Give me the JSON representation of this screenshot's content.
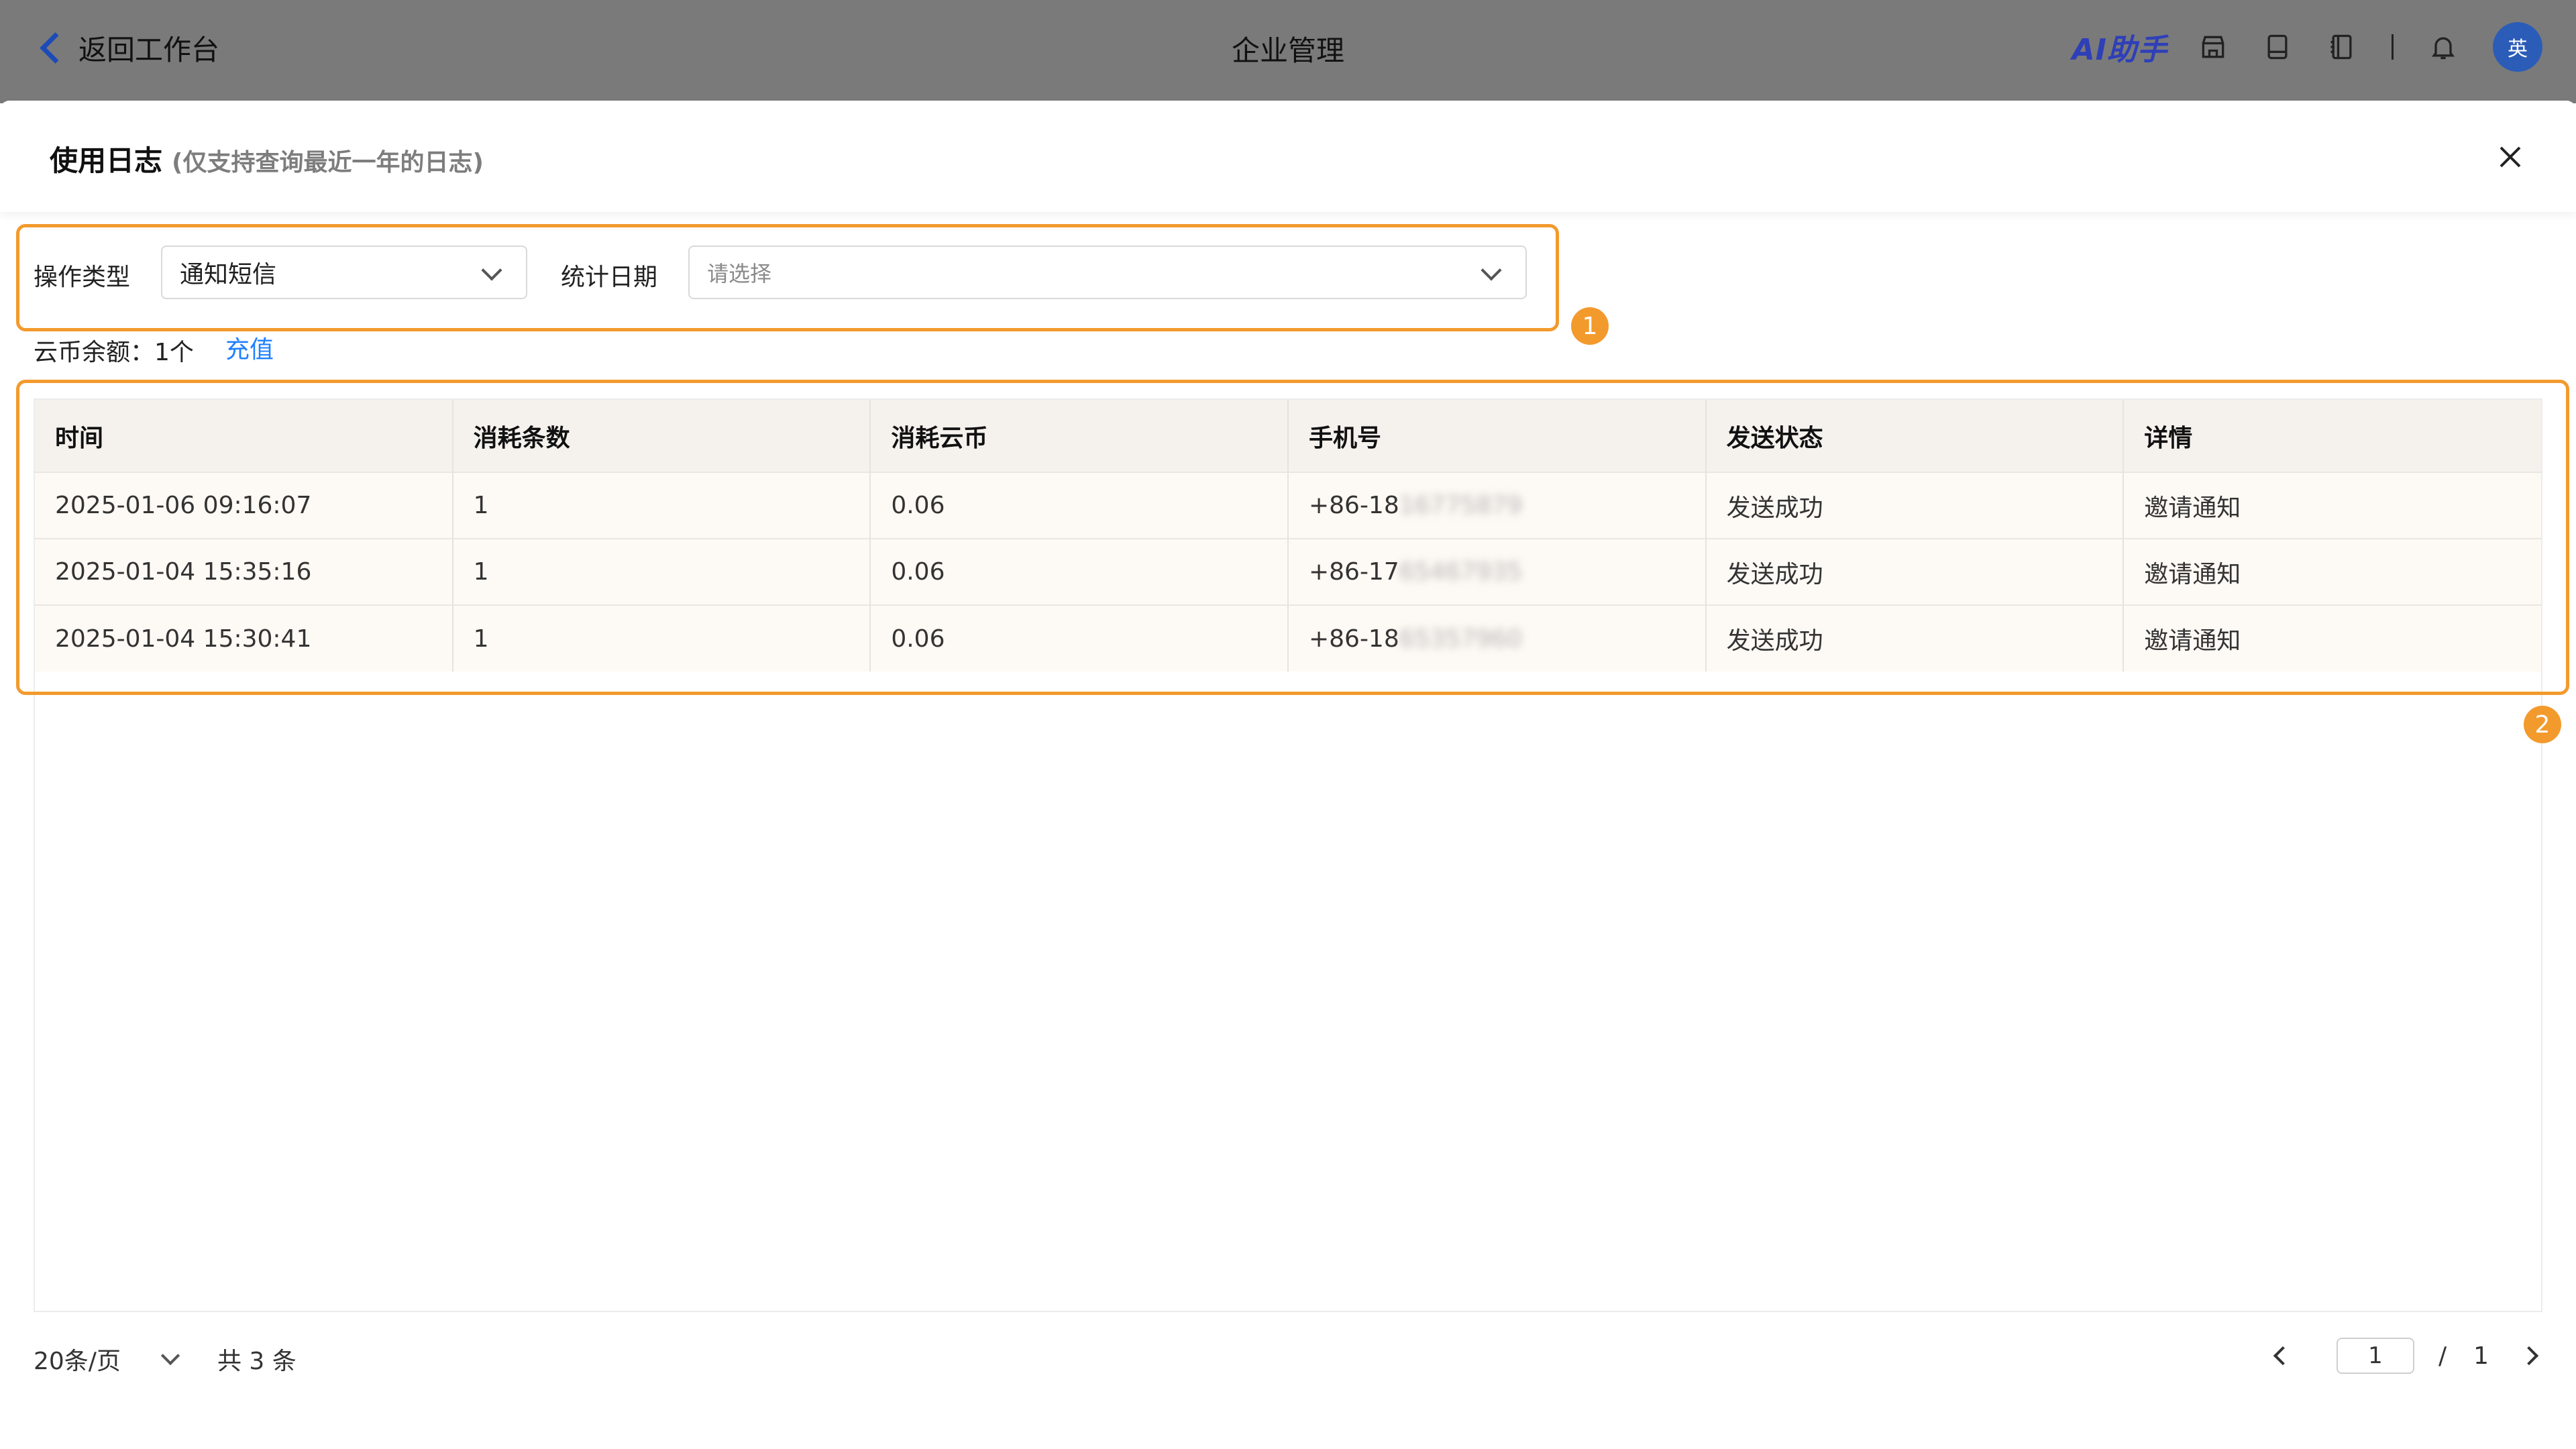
{
  "topbar": {
    "back_label": "返回工作台",
    "title": "企业管理",
    "ai_label": "AI助手",
    "avatar_text": "英",
    "accent": "#2e3fb8",
    "icons": [
      "store-icon",
      "book-icon",
      "notebook-icon",
      "bell-icon"
    ]
  },
  "dialog": {
    "title": "使用日志",
    "subtitle": "(仅支持查询最近一年的日志)"
  },
  "filters": {
    "op_type_label": "操作类型",
    "op_type_value": "通知短信",
    "date_label": "统计日期",
    "date_placeholder": "请选择"
  },
  "balance": {
    "text": "云币余额：1个",
    "recharge_label": "充值"
  },
  "annotations": {
    "badge1": "1",
    "badge2": "2",
    "highlight_color": "#f39a2d"
  },
  "table": {
    "columns": [
      "时间",
      "消耗条数",
      "消耗云币",
      "手机号",
      "发送状态",
      "详情"
    ],
    "rows": [
      {
        "time": "2025-01-06 09:16:07",
        "count": "1",
        "coins": "0.06",
        "phone_prefix": "+86-18",
        "phone_hidden": "16775879",
        "status": "发送成功",
        "detail": "邀请通知"
      },
      {
        "time": "2025-01-04 15:35:16",
        "count": "1",
        "coins": "0.06",
        "phone_prefix": "+86-17",
        "phone_hidden": "65467935",
        "status": "发送成功",
        "detail": "邀请通知"
      },
      {
        "time": "2025-01-04 15:30:41",
        "count": "1",
        "coins": "0.06",
        "phone_prefix": "+86-18",
        "phone_hidden": "65357960",
        "status": "发送成功",
        "detail": "邀请通知"
      }
    ]
  },
  "pagination": {
    "page_size": "20条/页",
    "total": "共 3 条",
    "current": "1",
    "slash": "/",
    "pages": "1"
  }
}
